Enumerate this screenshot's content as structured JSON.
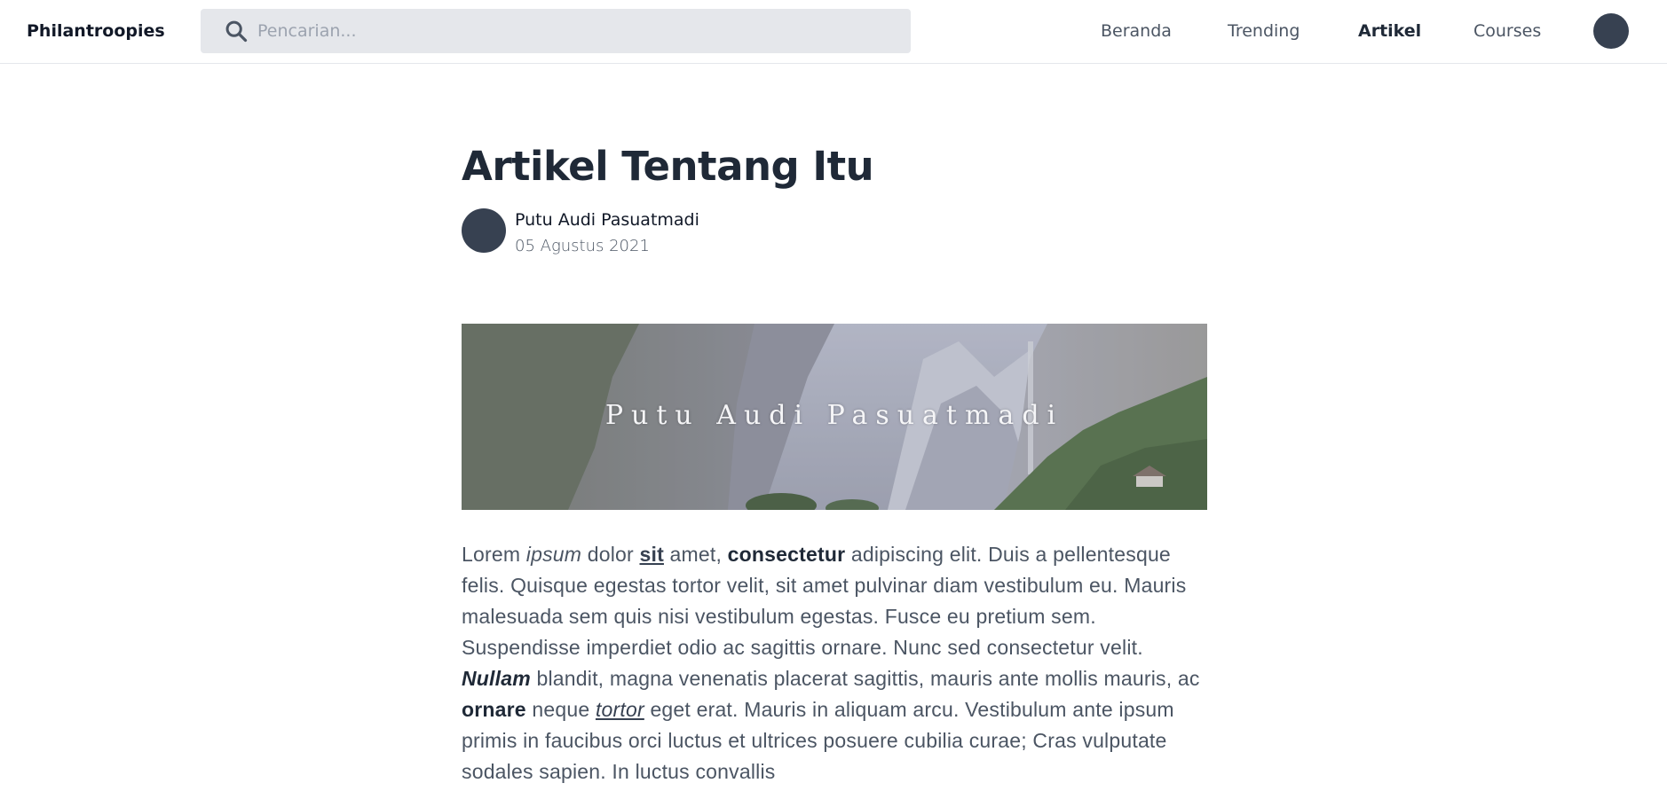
{
  "header": {
    "brand": "Philantroopies",
    "search_placeholder": "Pencarian...",
    "nav": {
      "beranda": "Beranda",
      "trending": "Trending",
      "artikel": "Artikel",
      "courses": "Courses"
    },
    "active_nav": "Artikel"
  },
  "article": {
    "title": "Artikel Tentang Itu",
    "author_name": "Putu Audi Pasuatmadi",
    "date": "05 Agustus 2021",
    "hero_caption": "Putu Audi Pasuatmadi",
    "body": {
      "w1": "Lorem",
      "w2": "ipsum",
      "w3": "dolor",
      "w4": "sit",
      "w5": "amet,",
      "w6": "consectetur",
      "seg1": "adipiscing elit. Duis a pellentesque felis. Quisque egestas tortor velit, sit amet pulvinar diam vestibulum eu. Mauris malesuada sem quis nisi vestibulum egestas. Fusce eu pretium sem. Suspendisse imperdiet odio ac sagittis ornare. Nunc sed consectetur velit.",
      "w7": "Nullam",
      "seg2": "blandit, magna venenatis placerat sagittis, mauris ante mollis mauris, ac",
      "w8": "ornare",
      "w9": "neque",
      "w10": "tortor",
      "seg3": "eget erat. Mauris in aliquam arcu. Vestibulum ante ipsum primis in faucibus orci luctus et ultrices posuere cubilia curae; Cras vulputate sodales sapien. In luctus convallis"
    }
  },
  "colors": {
    "avatar": "#374151",
    "search_bg": "#e5e7eb",
    "border": "#e5e7eb"
  },
  "icons": {
    "search": "search-icon"
  }
}
